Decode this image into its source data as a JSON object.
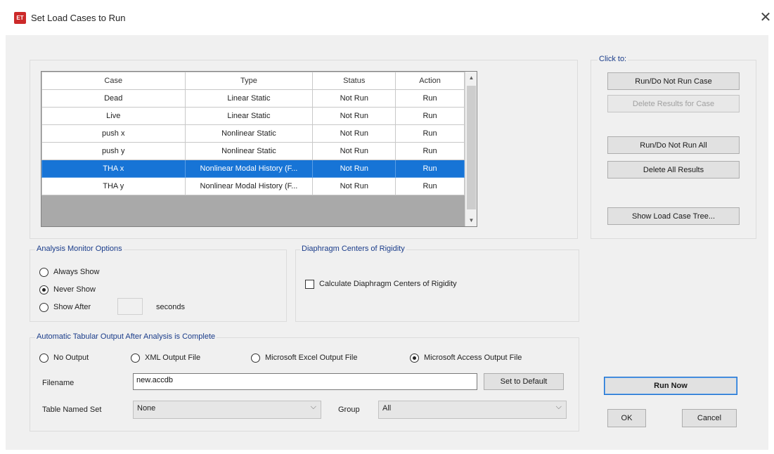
{
  "window": {
    "title": "Set Load Cases to Run",
    "app_icon": "ET"
  },
  "grid": {
    "columns": [
      "Case",
      "Type",
      "Status",
      "Action"
    ],
    "rows": [
      {
        "case": "Dead",
        "type": "Linear Static",
        "status": "Not Run",
        "action": "Run"
      },
      {
        "case": "Live",
        "type": "Linear Static",
        "status": "Not Run",
        "action": "Run"
      },
      {
        "case": "push x",
        "type": "Nonlinear Static",
        "status": "Not Run",
        "action": "Run"
      },
      {
        "case": "push y",
        "type": "Nonlinear Static",
        "status": "Not Run",
        "action": "Run"
      },
      {
        "case": "THA x",
        "type": "Nonlinear Modal History (F...",
        "status": "Not Run",
        "action": "Run",
        "selected": true
      },
      {
        "case": "THA y",
        "type": "Nonlinear Modal History (F...",
        "status": "Not Run",
        "action": "Run"
      }
    ]
  },
  "click_to": {
    "title": "Click to:",
    "run_do_not_run_case": "Run/Do Not Run Case",
    "delete_results_for_case": "Delete Results for Case",
    "run_do_not_run_all": "Run/Do Not Run All",
    "delete_all_results": "Delete All Results",
    "show_load_case_tree": "Show Load Case Tree..."
  },
  "monitor": {
    "title": "Analysis Monitor Options",
    "always_show": "Always Show",
    "never_show": "Never Show",
    "show_after": "Show After",
    "seconds_value": "",
    "seconds_label": "seconds",
    "selected": "never_show"
  },
  "diaphragm": {
    "title": "Diaphragm Centers of Rigidity",
    "checkbox_label": "Calculate Diaphragm Centers of Rigidity",
    "checked": false
  },
  "tabular": {
    "title": "Automatic Tabular Output After Analysis is Complete",
    "no_output": "No Output",
    "xml": "XML Output File",
    "excel": "Microsoft Excel Output File",
    "access": "Microsoft Access Output File",
    "selected": "access",
    "filename_label": "Filename",
    "filename_value": "new.accdb",
    "set_default": "Set to Default",
    "table_named_set_label": "Table Named Set",
    "table_named_set_value": "None",
    "group_label": "Group",
    "group_value": "All"
  },
  "actions": {
    "run_now": "Run Now",
    "ok": "OK",
    "cancel": "Cancel"
  },
  "colors": {
    "selection": "#1774d6",
    "group_title": "#1a3c8a",
    "app_icon": "#cc2a2a"
  }
}
